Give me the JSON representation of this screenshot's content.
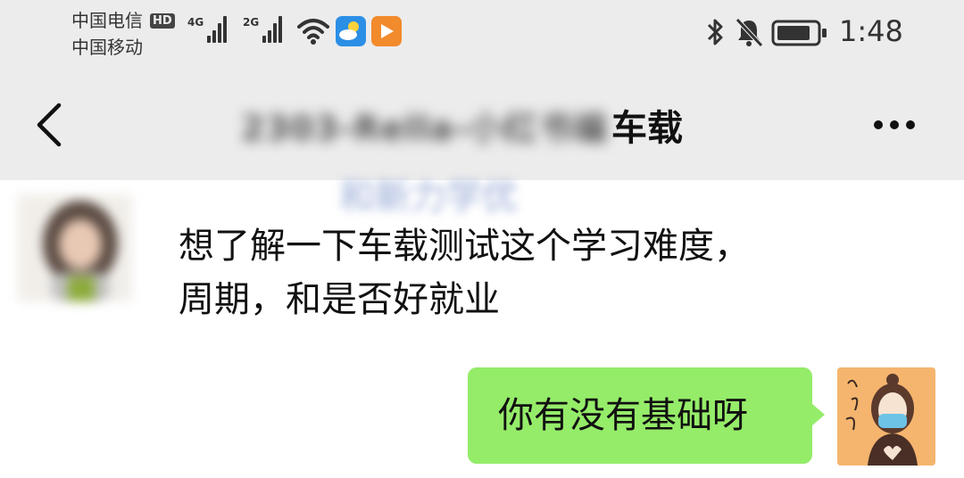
{
  "status_bar": {
    "carrier_1": "中国电信",
    "carrier_1_badge": "HD",
    "carrier_2": "中国移动",
    "network_1": "4G",
    "network_2": "2G",
    "time": "1:48",
    "icons": [
      "wifi-icon",
      "weather-app-icon",
      "video-app-icon",
      "bluetooth-icon",
      "mute-bell-icon",
      "battery-icon"
    ],
    "colors": {
      "weather_app": "#2b8fe6",
      "video_app": "#f28b2c"
    }
  },
  "header": {
    "title_obscured": "2303-Rella-小红书编",
    "title_visible": "车载",
    "back_icon": "chevron-left-icon",
    "more_icon": "more-dots-icon"
  },
  "chat": {
    "background_text_obscured": "和新力学优",
    "messages": [
      {
        "side": "left",
        "text": "想了解一下车载测试这个学习难度，周期，和是否好就业"
      },
      {
        "side": "right",
        "text": "你有没有基础呀"
      }
    ],
    "colors": {
      "bubble_right": "#95ec69",
      "bubble_left": "#ffffff"
    }
  }
}
